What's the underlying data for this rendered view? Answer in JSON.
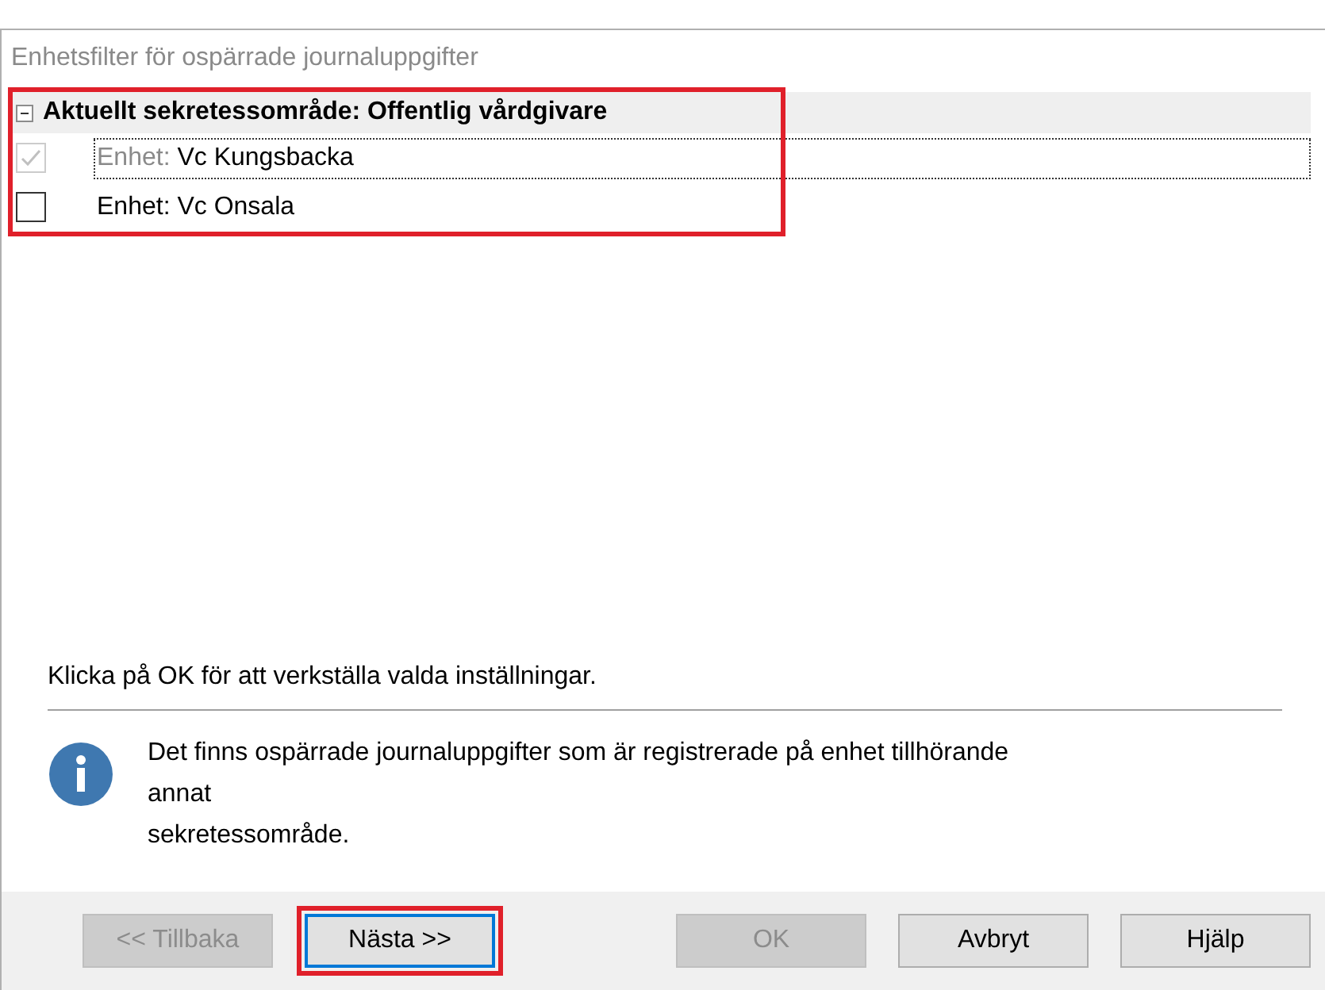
{
  "dialog": {
    "title": "Enhetsfilter för ospärrade journaluppgifter",
    "tree": {
      "highlighted": true,
      "group": {
        "label": "Aktuellt sekretessområde: Offentlig vårdgivare",
        "expanded": true,
        "items": [
          {
            "prefix": "Enhet:",
            "name": "Vc Kungsbacka",
            "checked": true,
            "disabled": true,
            "focused": true
          },
          {
            "prefix": "Enhet:",
            "name": "Vc Onsala",
            "checked": false,
            "disabled": false,
            "focused": false
          }
        ]
      }
    },
    "instruction": "Klicka på OK för att verkställa valda inställningar.",
    "info": {
      "lines": [
        "Det finns ospärrade journaluppgifter som är registrerade på enhet tillhörande",
        "annat",
        "sekretessområde."
      ]
    },
    "buttons": [
      {
        "label": "<< Tillbaka",
        "disabled": true,
        "focused": false,
        "highlighted": false
      },
      {
        "label": "Nästa >>",
        "disabled": false,
        "focused": true,
        "highlighted": true
      },
      {
        "label": "OK",
        "disabled": true,
        "focused": false,
        "highlighted": false
      },
      {
        "label": "Avbryt",
        "disabled": false,
        "focused": false,
        "highlighted": false
      },
      {
        "label": "Hjälp",
        "disabled": false,
        "focused": false,
        "highlighted": false
      }
    ]
  }
}
